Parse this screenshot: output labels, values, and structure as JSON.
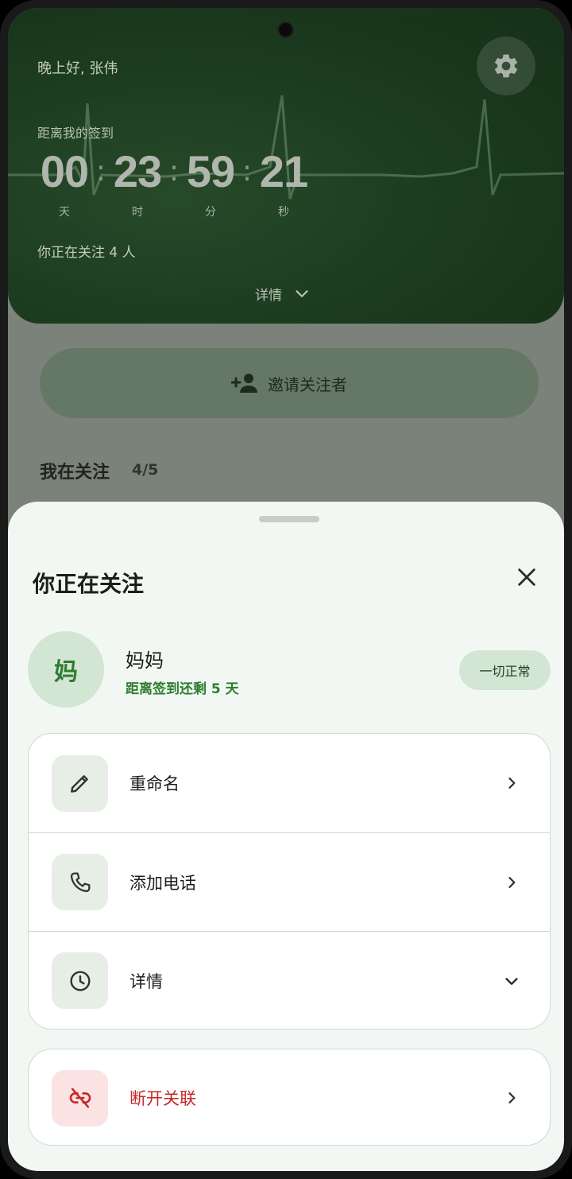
{
  "background": {
    "greeting": "晚上好, 张伟",
    "checkin_label": "距离我的签到",
    "timer": {
      "days": "00",
      "hours": "23",
      "minutes": "59",
      "seconds": "21",
      "days_unit": "天",
      "hours_unit": "时",
      "minutes_unit": "分",
      "seconds_unit": "秒"
    },
    "following_text": "你正在关注 4 人",
    "details_label": "详情",
    "invite_label": "邀请关注者",
    "section_title": "我在关注",
    "section_count": "4/5",
    "icons": {
      "settings": "gear-icon",
      "details": "chevron-down-icon",
      "invite": "person-add-icon"
    }
  },
  "sheet": {
    "title": "你正在关注",
    "contact": {
      "avatar_char": "妈",
      "name": "妈妈",
      "subtitle": "距离签到还剩 5 天",
      "status": "一切正常"
    },
    "options": [
      {
        "label": "重命名",
        "icon": "pencil-icon",
        "action": "chevron-right-icon"
      },
      {
        "label": "添加电话",
        "icon": "phone-icon",
        "action": "chevron-right-icon"
      },
      {
        "label": "详情",
        "icon": "clock-icon",
        "action": "chevron-down-icon"
      }
    ],
    "danger": {
      "label": "断开关联",
      "icon": "link-off-icon",
      "action": "chevron-right-icon"
    }
  },
  "colors": {
    "hero_green": "#1b3a1e",
    "accent_green": "#2e7d32",
    "badge_bg": "#d3e5d3",
    "danger_red": "#c62828",
    "sheet_bg": "#f3f7f3"
  }
}
